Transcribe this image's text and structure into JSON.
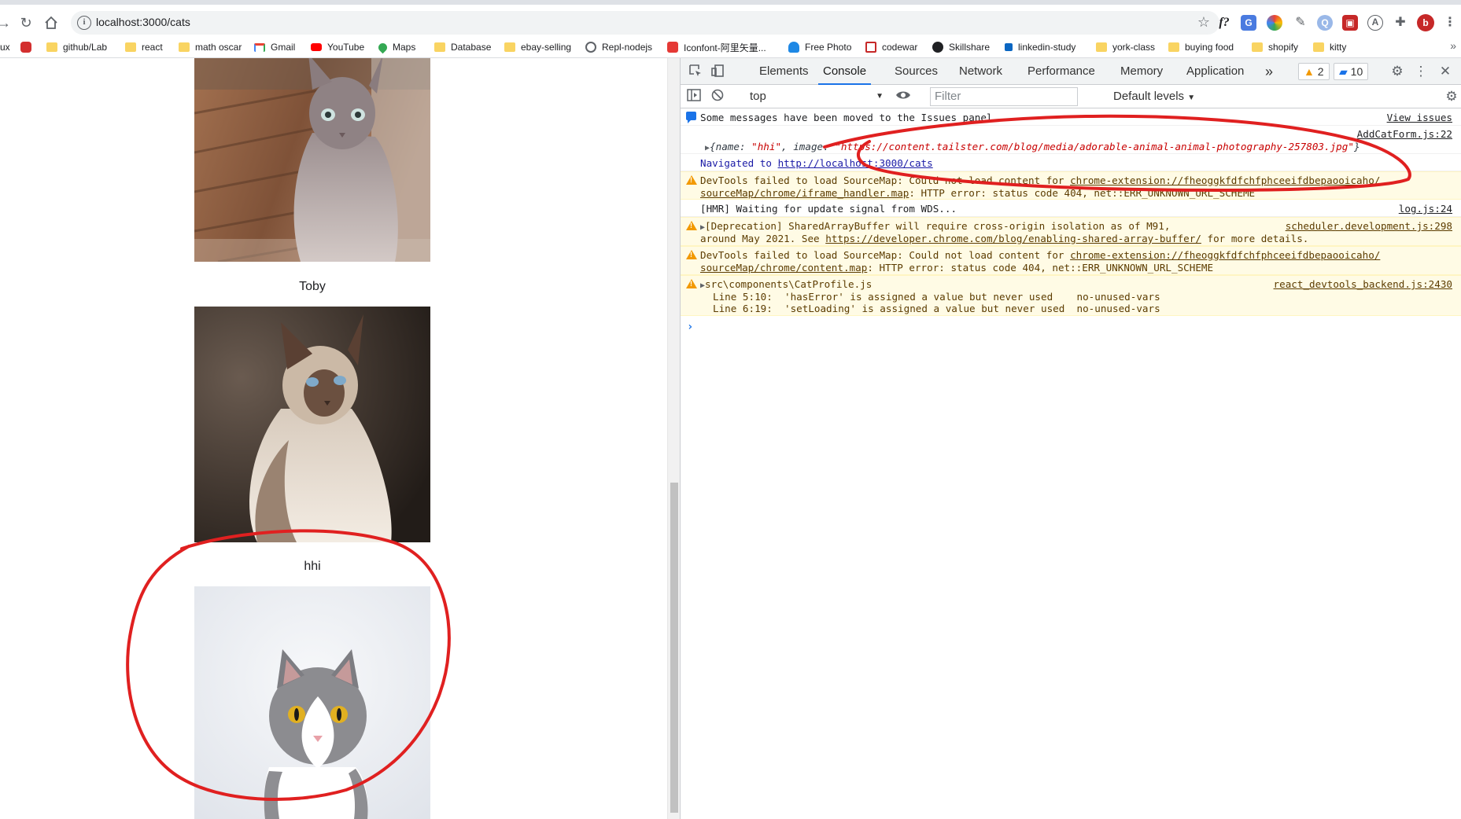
{
  "browser": {
    "url": "localhost:3000/cats",
    "extensions": [
      "f?",
      "G",
      "color-wheel",
      "pen",
      "Q",
      "red-ext",
      "A",
      "puzzle"
    ],
    "profile_initial": "b"
  },
  "bookmarks": [
    {
      "label": "ux",
      "icon": "none"
    },
    {
      "label": "",
      "icon": "red-logo"
    },
    {
      "label": "github/Lab",
      "icon": "folder"
    },
    {
      "label": "react",
      "icon": "folder"
    },
    {
      "label": "math oscar",
      "icon": "folder"
    },
    {
      "label": "Gmail",
      "icon": "gmail"
    },
    {
      "label": "YouTube",
      "icon": "youtube"
    },
    {
      "label": "Maps",
      "icon": "maps"
    },
    {
      "label": "Database",
      "icon": "folder"
    },
    {
      "label": "ebay-selling",
      "icon": "folder"
    },
    {
      "label": "Repl-nodejs",
      "icon": "repl"
    },
    {
      "label": "Iconfont-阿里矢量...",
      "icon": "iconfont"
    },
    {
      "label": "Free Photo",
      "icon": "freephoto"
    },
    {
      "label": "codewar",
      "icon": "codewars"
    },
    {
      "label": "Skillshare",
      "icon": "skillshare"
    },
    {
      "label": "linkedin-study",
      "icon": "linkedin"
    },
    {
      "label": "york-class",
      "icon": "folder"
    },
    {
      "label": "buying food",
      "icon": "folder"
    },
    {
      "label": "shopify",
      "icon": "folder"
    },
    {
      "label": "kitty",
      "icon": "folder"
    }
  ],
  "page": {
    "cats": [
      {
        "name": "Toby"
      },
      {
        "name": "hhi"
      }
    ]
  },
  "devtools": {
    "tabs": [
      "Elements",
      "Console",
      "Sources",
      "Network",
      "Performance",
      "Memory",
      "Application"
    ],
    "active_tab": "Console",
    "more_tabs": "»",
    "warning_count": "2",
    "message_count": "10",
    "context": "top",
    "filter_placeholder": "Filter",
    "levels": "Default levels"
  },
  "console": {
    "issues_notice": "Some messages have been moved to the Issues panel.",
    "view_issues": "View issues",
    "log_object_source": "AddCatForm.js:22",
    "log_object_prefix": "{name: ",
    "log_object_name": "\"hhi\"",
    "log_object_mid": ", image: ",
    "log_object_image": "\"https://content.tailster.com/blog/media/adorable-animal-animal-photography-257803.jpg\"",
    "log_object_suffix": "}",
    "navigated_prefix": "Navigated to ",
    "navigated_url": "http://localhost:3000/cats",
    "warn1_line1_prefix": "DevTools failed to load SourceMap: Could not load content for ",
    "warn1_line1_link": "chrome-extension://fheoggkfdfchfphceeifdbepaooicaho/",
    "warn1_line2_link": "sourceMap/chrome/iframe_handler.map",
    "warn1_line2_suffix": ": HTTP error: status code 404, net::ERR_UNKNOWN_URL_SCHEME",
    "hmr": "[HMR] Waiting for update signal from WDS...",
    "hmr_source": "log.js:24",
    "deprecation_line1": "[Deprecation] SharedArrayBuffer will require cross-origin isolation as of M91,",
    "deprecation_source": "scheduler.development.js:298",
    "deprecation_line2_prefix": "around May 2021. See ",
    "deprecation_link": "https://developer.chrome.com/blog/enabling-shared-array-buffer/",
    "deprecation_line2_suffix": " for more details.",
    "warn2_line1_prefix": "DevTools failed to load SourceMap: Could not load content for ",
    "warn2_line1_link": "chrome-extension://fheoggkfdfchfphceeifdbepaooicaho/",
    "warn2_line2_link": "sourceMap/chrome/content.map",
    "warn2_line2_suffix": ": HTTP error: status code 404, net::ERR_UNKNOWN_URL_SCHEME",
    "eslint_file": "src\\components\\CatProfile.js",
    "eslint_source": "react_devtools_backend.js:2430",
    "eslint_line1": "Line 5:10:  'hasError' is assigned a value but never used    no-unused-vars",
    "eslint_line2": "Line 6:19:  'setLoading' is assigned a value but never used  no-unused-vars",
    "prompt": "›"
  },
  "colors": {
    "annotation": "#e02020",
    "devtools_accent": "#1a73e8",
    "warning": "#f29900"
  }
}
